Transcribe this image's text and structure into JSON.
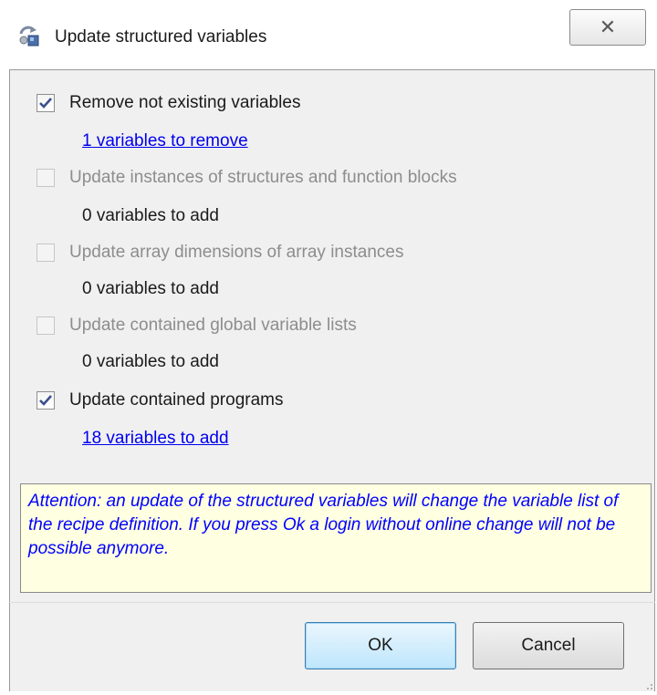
{
  "window": {
    "title": "Update structured variables",
    "close_symbol": "✕"
  },
  "options": [
    {
      "label": "Remove not existing variables",
      "checked": true,
      "enabled": true,
      "count_text": "1 variables to remove",
      "count_is_link": true
    },
    {
      "label": "Update instances of structures and function blocks",
      "checked": false,
      "enabled": false,
      "count_text": "0 variables to add",
      "count_is_link": false
    },
    {
      "label": "Update array dimensions of array instances",
      "checked": false,
      "enabled": false,
      "count_text": "0 variables to add",
      "count_is_link": false
    },
    {
      "label": "Update contained global variable lists",
      "checked": false,
      "enabled": false,
      "count_text": "0 variables to add",
      "count_is_link": false
    },
    {
      "label": "Update contained programs",
      "checked": true,
      "enabled": true,
      "count_text": "18 variables to add",
      "count_is_link": true
    }
  ],
  "attention": {
    "text": "Attention: an update of the structured variables will change the variable list of the recipe definition. If you press Ok  a login without online change will not be possible anymore."
  },
  "buttons": {
    "ok_label": "OK",
    "cancel_label": "Cancel"
  },
  "colors": {
    "link": "#0000ee",
    "attention_text": "#0000ff",
    "attention_background": "#ffffe1",
    "check_mark": "#3a4f8c",
    "disabled_text": "#8d8d8d"
  },
  "icons": {
    "app": "gear-refresh-icon",
    "close": "close-icon",
    "checkbox": "check-icon"
  }
}
